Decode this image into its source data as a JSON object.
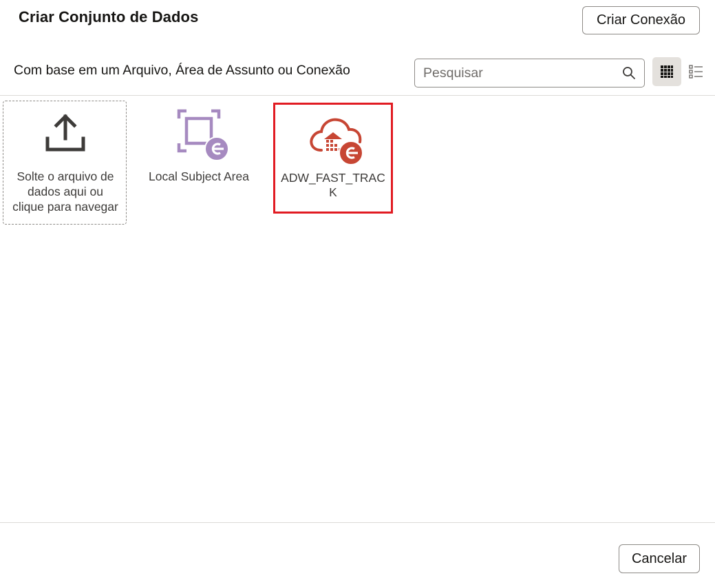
{
  "dialog": {
    "title": "Criar Conjunto de Dados",
    "create_connection_label": "Criar Conexão",
    "subtitle": "Com base em um Arquivo, Área de Assunto ou Conexão",
    "cancel_label": "Cancelar"
  },
  "search": {
    "placeholder": "Pesquisar",
    "value": "",
    "icon": "search-icon"
  },
  "view_toggle": {
    "selected": "grid",
    "grid_icon": "grid-view-icon",
    "list_icon": "list-view-icon"
  },
  "tiles": [
    {
      "label": "Solte o arquivo de dados aqui ou clique para navegar",
      "icon": "upload-icon"
    },
    {
      "label": "Local Subject Area",
      "icon": "subject-area-icon",
      "color": "#a68ac0"
    },
    {
      "label": "ADW_FAST_TRACK",
      "icon": "cloud-database-icon",
      "color": "#c74634",
      "highlighted": true
    }
  ],
  "colors": {
    "highlight_border": "#e11b22",
    "subject_area": "#a68ac0",
    "connection": "#c74634"
  }
}
